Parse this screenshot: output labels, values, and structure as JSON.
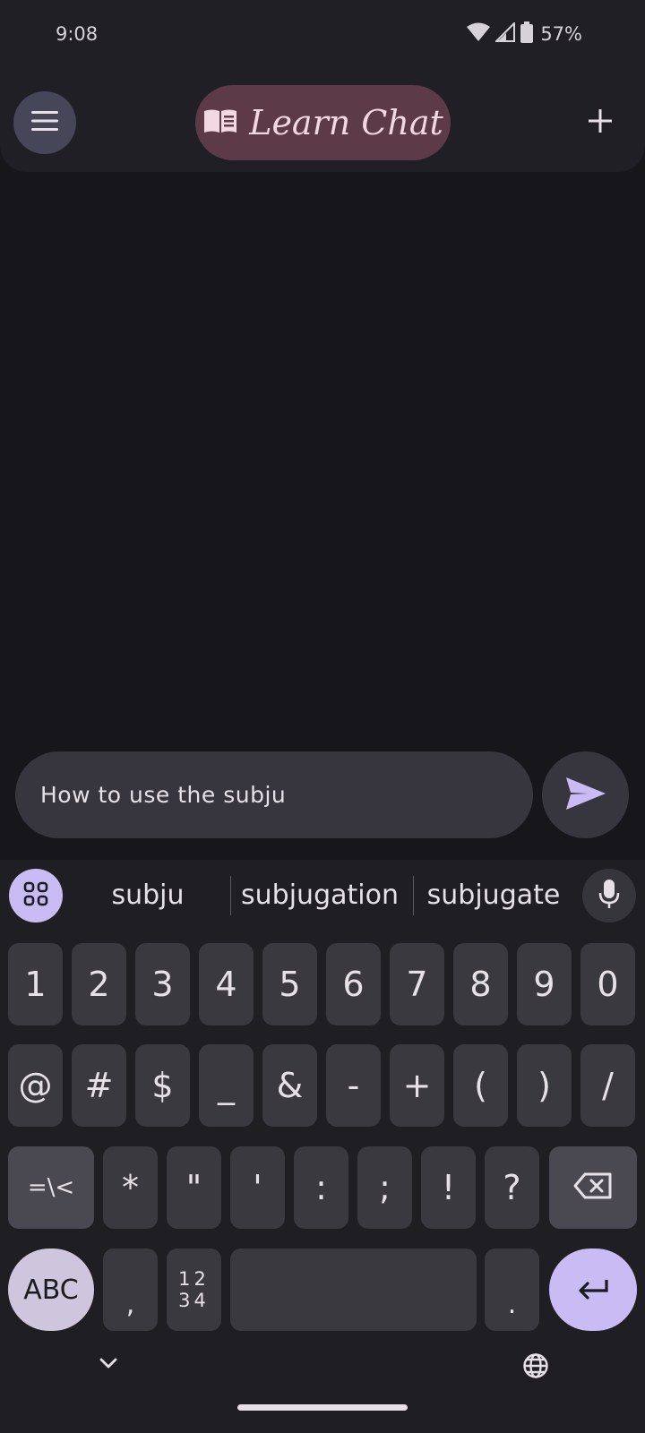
{
  "status_bar": {
    "time": "9:08",
    "battery_pct": "57%"
  },
  "app_bar": {
    "title": "Learn Chat"
  },
  "composer": {
    "input_value": "How to use the subju"
  },
  "keyboard": {
    "suggestions": [
      "subju",
      "subjugation",
      "subjugate"
    ],
    "row1": [
      "1",
      "2",
      "3",
      "4",
      "5",
      "6",
      "7",
      "8",
      "9",
      "0"
    ],
    "row2": [
      "@",
      "#",
      "$",
      "_",
      "&",
      "-",
      "+",
      "(",
      ")",
      "/"
    ],
    "row3_mod": "=\\<",
    "row3": [
      "*",
      "\"",
      "'",
      ":",
      ";",
      "!",
      "?"
    ],
    "abc_label": "ABC",
    "comma": ",",
    "numpad_label_top": "12",
    "numpad_label_bottom": "34",
    "period": "."
  },
  "colors": {
    "accent": "#c9bcf5",
    "title_pill": "#5c3a48",
    "background": "#17161b"
  }
}
